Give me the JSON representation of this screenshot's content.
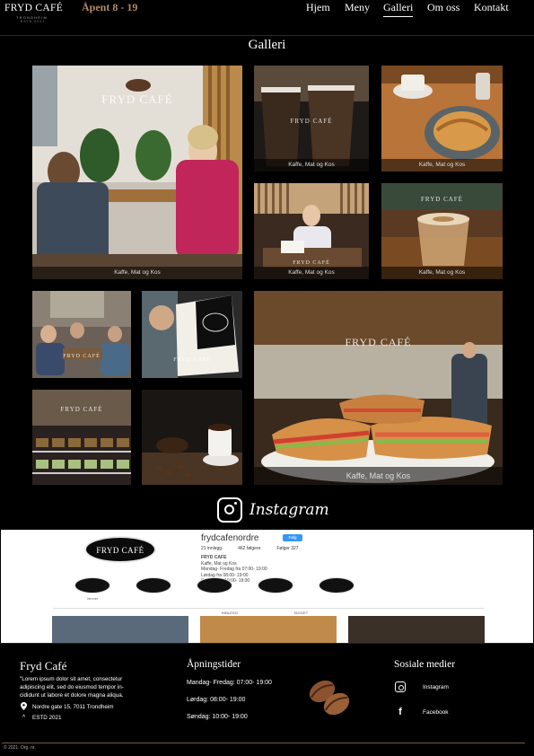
{
  "header": {
    "logo": {
      "name": "FRYD CAFÉ",
      "sub": "TRONDHEIM",
      "estd": "ESTD 2021"
    },
    "open_hours": "Åpent 8 - 19",
    "nav": [
      {
        "label": "Hjem",
        "active": false
      },
      {
        "label": "Meny",
        "active": false
      },
      {
        "label": "Galleri",
        "active": true
      },
      {
        "label": "Om oss",
        "active": false
      },
      {
        "label": "Kontakt",
        "active": false
      }
    ]
  },
  "gallery": {
    "title": "Galleri",
    "watermark": "FRYD CAFÉ",
    "caption": "Kaffe, Mat og Kos"
  },
  "instagram": {
    "heading": "Instagram",
    "embed": {
      "username": "frydcafenordre",
      "follow_label": "Følg",
      "stats": [
        "21 innlegg",
        "462 følgere",
        "Følger 327"
      ],
      "bio_name": "FRYD CAFE",
      "bio_lines": [
        "Kaffe, Mat og Kos",
        "Mandag- Fredag fra 07:00- 19:00",
        "Lørdag fra 08:00- 19:00",
        "Søndag fra 10:00- 19:00"
      ],
      "avatar_text": "FRYD CAFÉ",
      "highlights": [
        "Venner",
        "",
        "",
        "",
        ""
      ],
      "tabs": [
        "INNLEGG",
        "TAGGET"
      ]
    }
  },
  "footer": {
    "brand": "Fryd Café",
    "lorem": "\"Lorem ipsum dolor sit amet, consectetur adipiscing elit, sed do eiusmod tempor in-cididunt ut labore et dolore magna aliqua.",
    "address": "Nordre gate 15, 7011 Trondheim",
    "estd": "ESTD 2021",
    "hours_title": "Åpningstider",
    "hours": [
      "Mandag- Fredag: 07:00- 19:00",
      "Lørdag: 08:00- 19:00",
      "Søndag: 10:00- 19:00"
    ],
    "social_title": "Sosiale medier",
    "social": [
      "Instagram",
      "Facebook"
    ],
    "copyright": "© 2021. Org. nr."
  },
  "colors": {
    "accent": "#b48a66",
    "background": "#000000",
    "divider": "#7a5a40"
  }
}
